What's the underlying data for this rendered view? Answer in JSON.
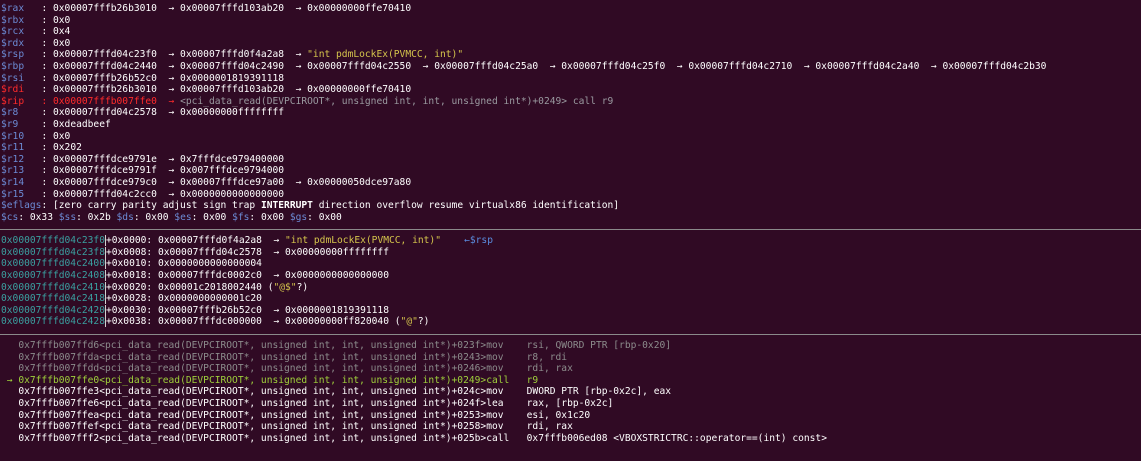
{
  "colors": {
    "background": "#300a24",
    "register": "#6c8bd5",
    "changed_register": "#ff2b2b",
    "string": "#d4c44c",
    "stack_address": "#3aa0a0",
    "current_instruction": "#9fd03b",
    "past_instruction": "#8c8c8c"
  },
  "arrow": "→",
  "registers": [
    {
      "name": "$rax   ",
      "value": ": 0x00007fffb26b3010  → 0x00007fffd103ab20  → 0x00000000ffe70410"
    },
    {
      "name": "$rbx   ",
      "value": ": 0x0"
    },
    {
      "name": "$rcx   ",
      "value": ": 0x4"
    },
    {
      "name": "$rdx   ",
      "value": ": 0x0"
    },
    {
      "name": "$rsp   ",
      "value": ": 0x00007fffd04c23f0  → 0x00007fffd0f4a2a8  → ",
      "str": "\"int pdmLockEx(PVMCC, int)\""
    },
    {
      "name": "$rbp   ",
      "value": ": 0x00007fffd04c2440  → 0x00007fffd04c2490  → 0x00007fffd04c2550  → 0x00007fffd04c25a0  → 0x00007fffd04c25f0  → 0x00007fffd04c2710  → 0x00007fffd04c2a40  → 0x00007fffd04c2b30"
    },
    {
      "name": "$rsi   ",
      "value": ": 0x00007fffb26b52c0  → 0x0000001819391118"
    },
    {
      "name": "$rdi   ",
      "value": ": 0x00007fffb26b3010  → 0x00007fffd103ab20  → 0x00000000ffe70410",
      "changed": true
    },
    {
      "name": "$rip   ",
      "value": ": 0x00007fffb007ffe0  → ",
      "tail": "<pci_data_read(DEVPCIROOT*, unsigned int, int, unsigned int*)+0249> call r9",
      "rip": true
    },
    {
      "name": "$r8    ",
      "value": ": 0x00007fffd04c2578  → 0x00000000ffffffff"
    },
    {
      "name": "$r9    ",
      "value": ": 0xdeadbeef"
    },
    {
      "name": "$r10   ",
      "value": ": 0x0"
    },
    {
      "name": "$r11   ",
      "value": ": 0x202"
    },
    {
      "name": "$r12   ",
      "value": ": 0x00007fffdce9791e  → 0x7fffdce979400000"
    },
    {
      "name": "$r13   ",
      "value": ": 0x00007fffdce9791f  → 0x007fffdce9794000"
    },
    {
      "name": "$r14   ",
      "value": ": 0x00007fffdce979c0  → 0x00007fffdce97a00  → 0x00000050dce97a80"
    },
    {
      "name": "$r15   ",
      "value": ": 0x00007fffd04c2cc0  → 0x0000000000000000"
    }
  ],
  "eflags": {
    "name": "$eflags",
    "pre": ": [zero carry parity adjust sign trap ",
    "bold": "INTERRUPT",
    "post": " direction overflow resume virtualx86 identification]"
  },
  "segments": [
    {
      "name": "$cs",
      "value": ": 0x33 "
    },
    {
      "name": "$ss",
      "value": ": 0x2b "
    },
    {
      "name": "$ds",
      "value": ": 0x00 "
    },
    {
      "name": "$es",
      "value": ": 0x00 "
    },
    {
      "name": "$fs",
      "value": ": 0x00 "
    },
    {
      "name": "$gs",
      "value": ": 0x00"
    }
  ],
  "stack": [
    {
      "addr": "0x00007fffd04c23f0",
      "rest": "+0x0000: 0x00007fffd0f4a2a8  → ",
      "str": "\"int pdmLockEx(PVMCC, int)\"",
      "marker": "    ←$rsp"
    },
    {
      "addr": "0x00007fffd04c23f8",
      "rest": "+0x0008: 0x00007fffd04c2578  → 0x00000000ffffffff"
    },
    {
      "addr": "0x00007fffd04c2400",
      "rest": "+0x0010: 0x0000000000000004"
    },
    {
      "addr": "0x00007fffd04c2408",
      "rest": "+0x0018: 0x00007fffdc0002c0  → 0x0000000000000000"
    },
    {
      "addr": "0x00007fffd04c2410",
      "rest": "+0x0020: 0x00001c2018002440 (",
      "str": "\"@$\"",
      "post": "?)"
    },
    {
      "addr": "0x00007fffd04c2418",
      "rest": "+0x0028: 0x0000000000001c20"
    },
    {
      "addr": "0x00007fffd04c2420",
      "rest": "+0x0030: 0x00007fffb26b52c0  → 0x0000001819391118"
    },
    {
      "addr": "0x00007fffd04c2428",
      "rest": "+0x0038: 0x00007fffdc000000  → 0x00000000ff820040 (",
      "str": "\"@\"",
      "post": "?)"
    }
  ],
  "code": [
    {
      "prefix": "   ",
      "addr": "0x7fffb007ffd6",
      "func": "<pci_data_read(DEVPCIROOT*, unsigned int, int, unsigned int*)+023f>",
      "mn": "mov    ",
      "ops": "rsi, QWORD PTR [rbp-0x20]",
      "state": "past"
    },
    {
      "prefix": "   ",
      "addr": "0x7fffb007ffda",
      "func": "<pci_data_read(DEVPCIROOT*, unsigned int, int, unsigned int*)+0243>",
      "mn": "mov    ",
      "ops": "r8, rdi",
      "state": "past"
    },
    {
      "prefix": "   ",
      "addr": "0x7fffb007ffdd",
      "func": "<pci_data_read(DEVPCIROOT*, unsigned int, int, unsigned int*)+0246>",
      "mn": "mov    ",
      "ops": "rdi, rax",
      "state": "past"
    },
    {
      "prefix": " → ",
      "addr": "0x7fffb007ffe0",
      "func": "<pci_data_read(DEVPCIROOT*, unsigned int, int, unsigned int*)+0249>",
      "mn": "call   ",
      "ops": "r9",
      "state": "current"
    },
    {
      "prefix": "   ",
      "addr": "0x7fffb007ffe3",
      "func": "<pci_data_read(DEVPCIROOT*, unsigned int, int, unsigned int*)+024c>",
      "mn": "mov    ",
      "ops": "DWORD PTR [rbp-0x2c], eax",
      "state": "next"
    },
    {
      "prefix": "   ",
      "addr": "0x7fffb007ffe6",
      "func": "<pci_data_read(DEVPCIROOT*, unsigned int, int, unsigned int*)+024f>",
      "mn": "lea    ",
      "ops": "rax, [rbp-0x2c]",
      "state": "next"
    },
    {
      "prefix": "   ",
      "addr": "0x7fffb007ffea",
      "func": "<pci_data_read(DEVPCIROOT*, unsigned int, int, unsigned int*)+0253>",
      "mn": "mov    ",
      "ops": "esi, 0x1c20",
      "state": "next"
    },
    {
      "prefix": "   ",
      "addr": "0x7fffb007ffef",
      "func": "<pci_data_read(DEVPCIROOT*, unsigned int, int, unsigned int*)+0258>",
      "mn": "mov    ",
      "ops": "rdi, rax",
      "state": "next"
    },
    {
      "prefix": "   ",
      "addr": "0x7fffb007fff2",
      "func": "<pci_data_read(DEVPCIROOT*, unsigned int, int, unsigned int*)+025b>",
      "mn": "call   ",
      "ops": "0x7fffb006ed08 <VBOXSTRICTRC::operator==(int) const>",
      "state": "next"
    }
  ]
}
